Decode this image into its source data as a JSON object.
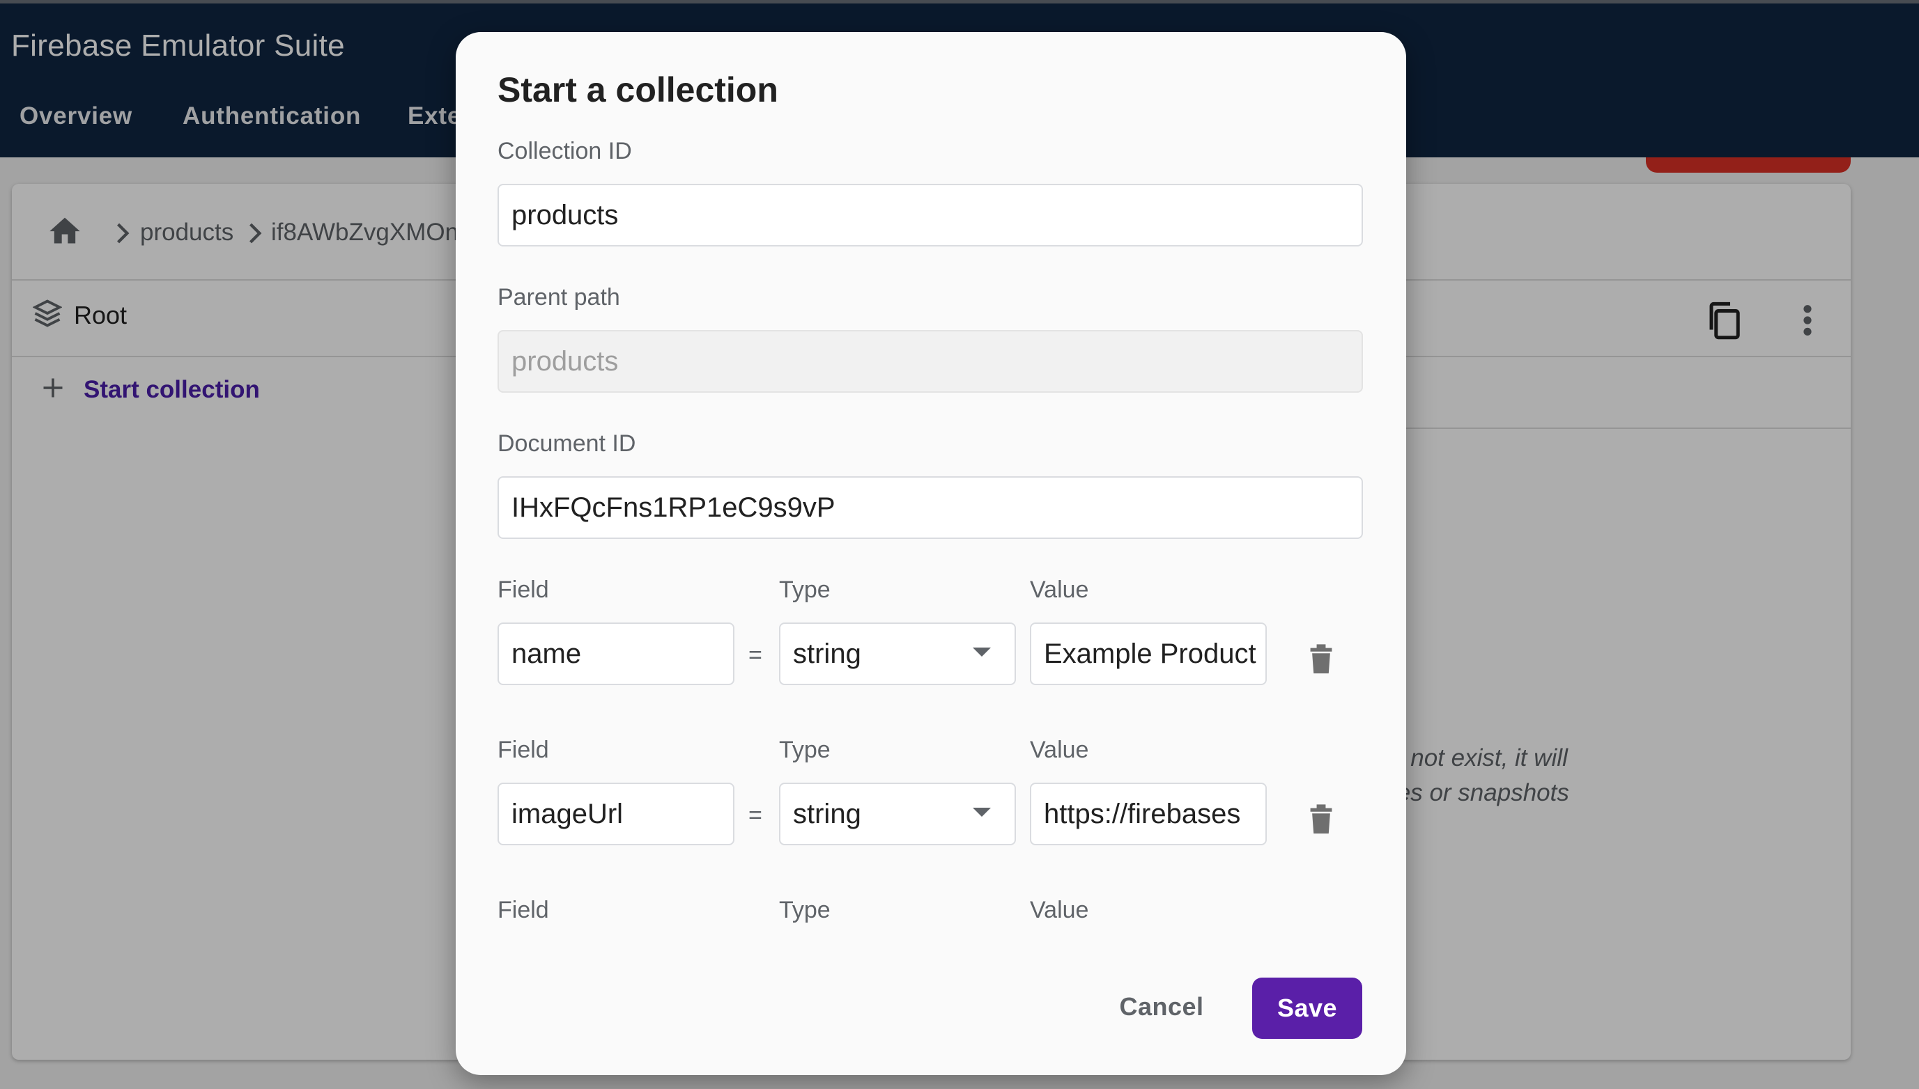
{
  "app": {
    "title": "Firebase Emulator Suite",
    "tabs": [
      "Overview",
      "Authentication",
      "Exte"
    ]
  },
  "breadcrumb": {
    "home_icon": "home-icon",
    "items": [
      "products",
      "if8AWbZvgXMOn"
    ]
  },
  "root": {
    "label": "Root",
    "start_collection": "Start collection"
  },
  "empty_state": {
    "line1": "s not exist, it will",
    "line2": "ies or snapshots"
  },
  "dialog": {
    "title": "Start a collection",
    "collection_id_label": "Collection ID",
    "collection_id_value": "products",
    "parent_path_label": "Parent path",
    "parent_path_value": "products",
    "document_id_label": "Document ID",
    "document_id_value": "IHxFQcFns1RP1eC9s9vP",
    "column_labels": {
      "field": "Field",
      "type": "Type",
      "value": "Value"
    },
    "equals": "=",
    "rows": [
      {
        "field": "name",
        "type": "string",
        "value": "Example Product"
      },
      {
        "field": "imageUrl",
        "type": "string",
        "value": "https://firebases"
      }
    ],
    "cancel_label": "Cancel",
    "save_label": "Save"
  },
  "colors": {
    "appbar": "#0f2642",
    "accent_purple": "#5a1fa8",
    "link_purple": "#4a1ea8",
    "danger_red": "#d93025"
  }
}
